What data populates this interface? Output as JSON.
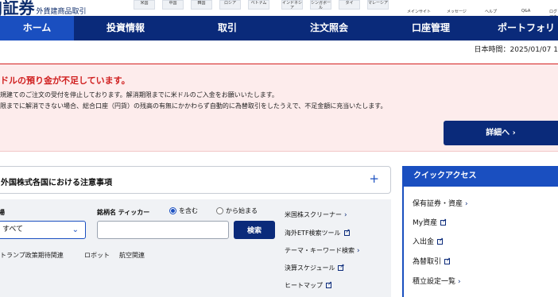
{
  "header": {
    "logo_text": "J証券",
    "logo_sub": "外貨建商品取引",
    "markets": [
      "米国",
      "中国",
      "韓国",
      "ロシア",
      "ベトナム",
      "インドネシア",
      "シンガポール",
      "タイ",
      "マレーシア"
    ],
    "utilities": [
      "メインサイト",
      "メッセージ",
      "ヘルプ",
      "Q&A",
      "ログアウト"
    ]
  },
  "nav": {
    "items": [
      "ホーム",
      "投資情報",
      "取引",
      "注文照会",
      "口座管理",
      "ポートフォリ"
    ],
    "active_index": 0
  },
  "time": "日本時間：2025/01/07 1",
  "alert": {
    "title": "ドルの預り金が不足しています。",
    "line1": "規建てのご注文の受付を停止しております。解消期限までに米ドルのご入金をお願いいたします。",
    "line2": "限までに解消できない場合、総合口座（円貨）の残高の有無にかかわらず自動的に為替取引をしたうえで、不足金額に充当いたします。",
    "detail_button": "詳細へ ›"
  },
  "notice": {
    "title": "外国株式各国における注意事項",
    "expand": "+"
  },
  "search": {
    "market_label": "場",
    "market_value": "すべて",
    "name_label": "銘柄名 ティッカー",
    "radio_contains": "を含む",
    "radio_starts": "から始まる",
    "input_placeholder": "",
    "button": "検索",
    "tags": [
      "トランプ政策期待関連",
      "ロボット",
      "航空関連"
    ]
  },
  "links": [
    {
      "label": "米国株スクリーナー",
      "icon": "chevron-right-icon"
    },
    {
      "label": "海外ETF検索ツール",
      "icon": "external-link-icon"
    },
    {
      "label": "テーマ・キーワード検索",
      "icon": "chevron-right-icon"
    },
    {
      "label": "決算スケジュール",
      "icon": "external-link-icon"
    },
    {
      "label": "ヒートマップ",
      "icon": "external-link-icon"
    }
  ],
  "quick_access": {
    "title": "クイックアクセス",
    "items": [
      {
        "label": "保有証券・資産",
        "icon": "chevron-right-icon"
      },
      {
        "label": "My資産",
        "icon": "external-link-icon"
      },
      {
        "label": "入出金",
        "icon": "external-link-icon"
      },
      {
        "label": "為替取引",
        "icon": "external-link-icon"
      },
      {
        "label": "積立設定一覧",
        "icon": "chevron-right-icon"
      }
    ]
  },
  "colors": {
    "navy": "#0a2a7a",
    "accent_blue": "#1a4fc0",
    "alert_red": "#d01f1f",
    "alert_bg": "#fdecec"
  }
}
